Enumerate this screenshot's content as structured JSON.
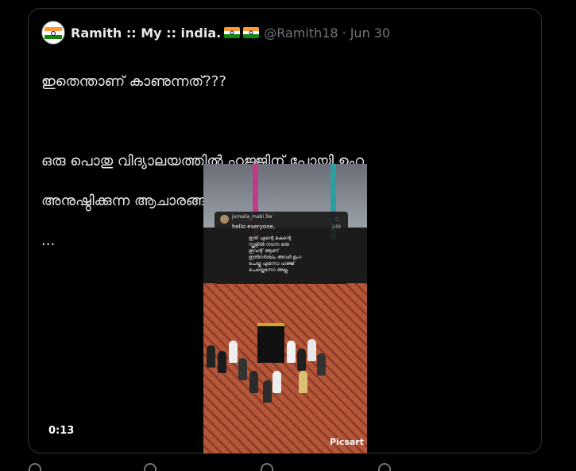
{
  "tweet": {
    "display_name": "Ramith :: My :: india.",
    "handle": "@Ramith18",
    "separator": "·",
    "date": "Jun 30",
    "text_line1": "ഇതെന്താണ് കാണുന്നത്???",
    "text_line2": "ഒരു പൊതു വിദ്യാലയത്തിൽ ഹജ്ജിന് പോയി ഉംറ",
    "text_line3": "അനുഷ്ഠിക്കുന്ന ആചാരങ്ങൾ പറിപ്പിക്കുന്നു...",
    "text_line4": "..."
  },
  "video": {
    "duration": "0:13",
    "watermark": "Picsart",
    "overlay": {
      "username": "jumaila_mabi",
      "age": "3w",
      "greeting": "hello everyone,",
      "body": "ഇത് എന്റെ മകന്റെ\nസ്കൂളിൽ നടന്ന ഒരു\nഇവന്റ് ആണ്\nഇതിനർത്ഥം അവർ ഉംറ\nചെയ്തു എന്നോ ഹജ്ജ്\nചെയ്തെന്നോ അല്ല",
      "like_count": "248"
    }
  },
  "icons": {
    "avatar": "india-flag-avatar",
    "flag": "india-flag-icon",
    "heart": "heart-icon"
  }
}
